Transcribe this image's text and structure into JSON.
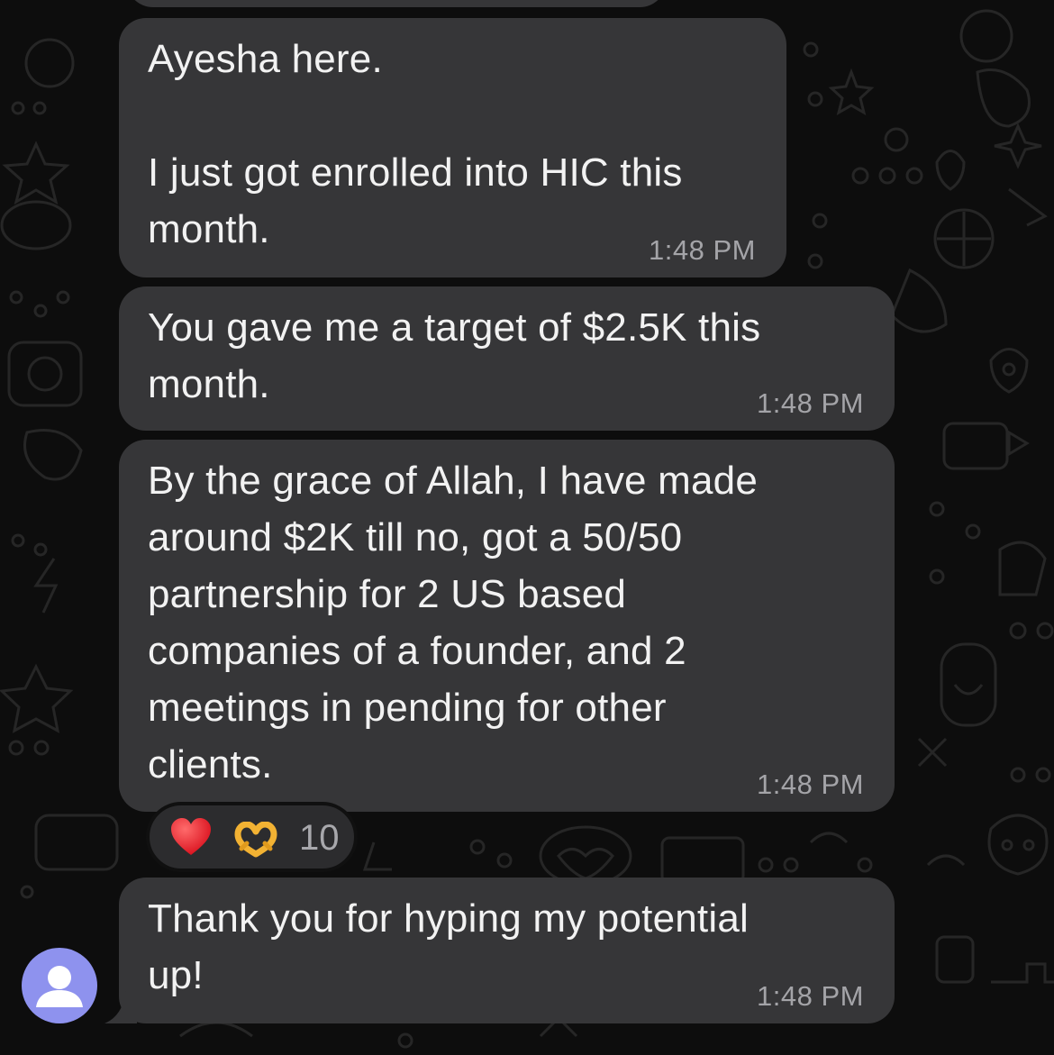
{
  "messages": [
    {
      "text": "Ayesha here.\n\nI just got enrolled into HIC this\nmonth.",
      "time": "1:48 PM"
    },
    {
      "text": "You gave me a target of $2.5K this\nmonth.",
      "time": "1:48 PM"
    },
    {
      "text": "By the grace of Allah, I have made\naround $2K till no, got a 50/50\npartnership for 2 US based\ncompanies of a founder, and 2\nmeetings in pending for other\nclients.",
      "time": "1:48 PM"
    },
    {
      "text": "Thank you for hyping my potential\nup!",
      "time": "1:48 PM"
    }
  ],
  "reactions": {
    "icons": [
      "red-heart-icon",
      "heart-hands-icon"
    ],
    "count": "10"
  },
  "avatar": {
    "icon": "default-user-icon",
    "color": "#8e92ee"
  },
  "colors": {
    "background": "#0d0d0d",
    "bubble": "#363638",
    "timestamp": "#a4a4a8"
  }
}
